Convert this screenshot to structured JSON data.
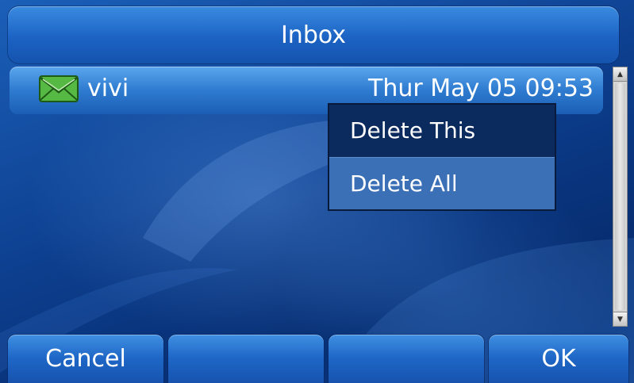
{
  "header": {
    "title": "Inbox"
  },
  "messages": [
    {
      "sender": "vivi",
      "time": "Thur May 05 09:53",
      "icon": "envelope-icon"
    }
  ],
  "context_menu": {
    "items": [
      {
        "label": "Delete This",
        "selected": true
      },
      {
        "label": "Delete All",
        "selected": false
      }
    ]
  },
  "softkeys": [
    {
      "label": "Cancel"
    },
    {
      "label": ""
    },
    {
      "label": ""
    },
    {
      "label": "OK"
    }
  ],
  "colors": {
    "background": "#0d3f8f",
    "menu_selected": "#0b2a5e",
    "menu_normal": "#3b6fb6",
    "envelope_green": "#4caf3a"
  }
}
